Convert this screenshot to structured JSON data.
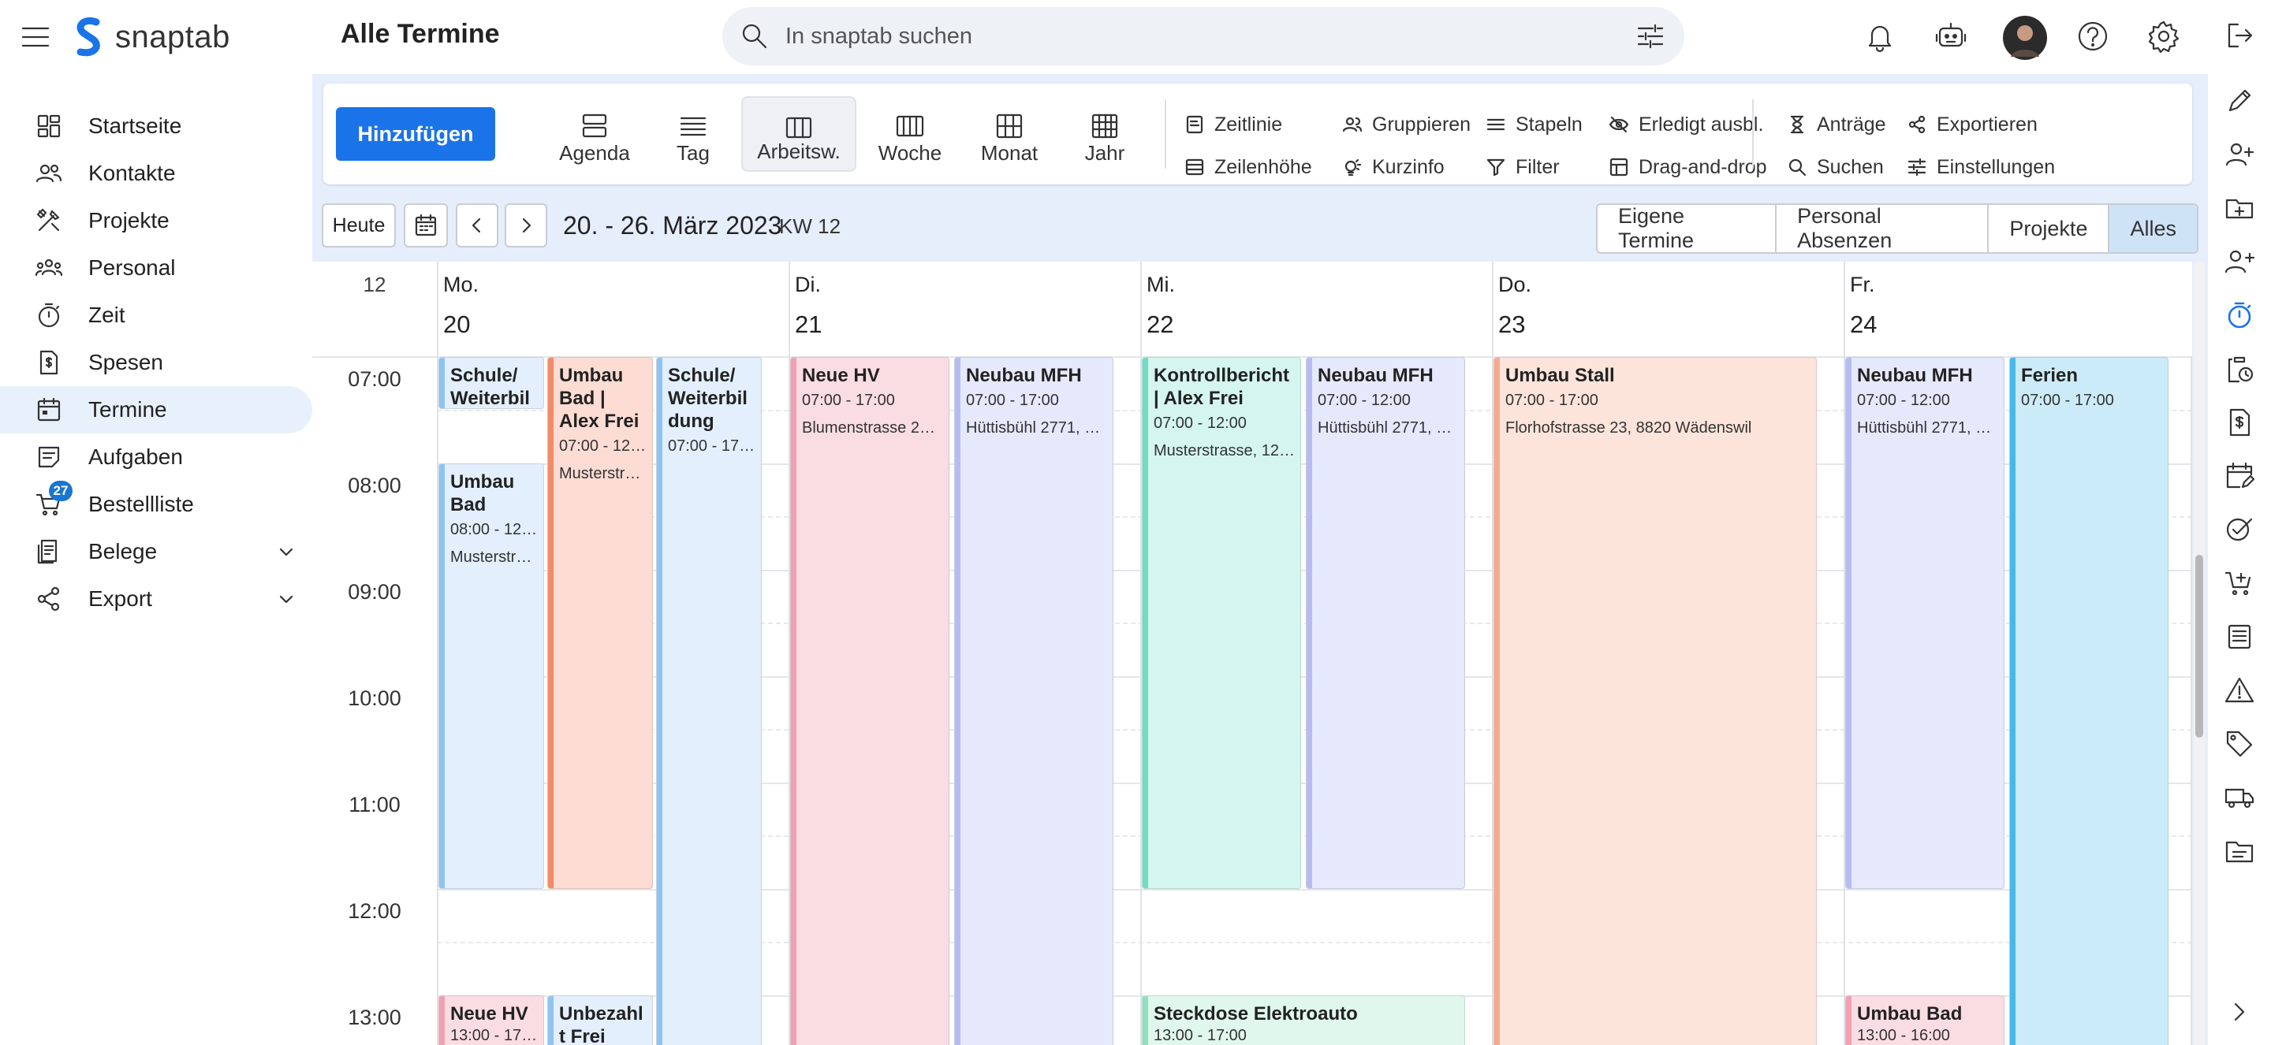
{
  "app": {
    "name": "snaptab",
    "page_title": "Alle Termine"
  },
  "search": {
    "placeholder": "In snaptab suchen"
  },
  "sidebar": {
    "items": [
      {
        "label": "Startseite",
        "icon": "dashboard-icon"
      },
      {
        "label": "Kontakte",
        "icon": "people-icon"
      },
      {
        "label": "Projekte",
        "icon": "tools-icon"
      },
      {
        "label": "Personal",
        "icon": "groups-icon"
      },
      {
        "label": "Zeit",
        "icon": "timer-icon"
      },
      {
        "label": "Spesen",
        "icon": "receipt-icon"
      },
      {
        "label": "Termine",
        "icon": "calendar-icon",
        "active": true
      },
      {
        "label": "Aufgaben",
        "icon": "task-icon"
      },
      {
        "label": "Bestellliste",
        "icon": "cart-icon",
        "badge": "27"
      },
      {
        "label": "Belege",
        "icon": "document-icon",
        "expandable": true
      },
      {
        "label": "Export",
        "icon": "share-icon",
        "expandable": true
      }
    ]
  },
  "toolbar": {
    "add_label": "Hinzufügen",
    "views": [
      {
        "label": "Agenda"
      },
      {
        "label": "Tag"
      },
      {
        "label": "Arbeitsw.",
        "active": true
      },
      {
        "label": "Woche"
      },
      {
        "label": "Monat"
      },
      {
        "label": "Jahr"
      }
    ],
    "options": {
      "zeitlinie": "Zeitlinie",
      "zeilenhoehe": "Zeilenhöhe",
      "gruppieren": "Gruppieren",
      "kurzinfo": "Kurzinfo",
      "stapeln": "Stapeln",
      "filter": "Filter",
      "erledigt": "Erledigt ausbl.",
      "dragdrop": "Drag-and-drop",
      "antraege": "Anträge",
      "suchen": "Suchen",
      "exportieren": "Exportieren",
      "einstellungen": "Einstellungen"
    }
  },
  "navigation": {
    "today_label": "Heute",
    "date_range": "20. - 26. März 2023",
    "week": "KW 12",
    "filters": [
      {
        "label": "Eigene Termine"
      },
      {
        "label": "Personal Absenzen"
      },
      {
        "label": "Projekte"
      },
      {
        "label": "Alles",
        "selected": true
      }
    ]
  },
  "calendar": {
    "week_number": "12",
    "days": [
      {
        "name": "Mo.",
        "date": "20"
      },
      {
        "name": "Di.",
        "date": "21"
      },
      {
        "name": "Mi.",
        "date": "22"
      },
      {
        "name": "Do.",
        "date": "23"
      },
      {
        "name": "Fr.",
        "date": "24"
      }
    ],
    "hours": [
      "07:00",
      "08:00",
      "09:00",
      "10:00",
      "11:00",
      "12:00",
      "13:00"
    ],
    "events": [
      {
        "title": "Schule/ Weiterbil",
        "time": "",
        "address": "",
        "color": "#e3effc",
        "bar": "#90c4f0"
      },
      {
        "title": "Umbau Bad",
        "time": "08:00 - 12:…",
        "address": "Musterstr…",
        "color": "#e3effc",
        "bar": "#90c4f0"
      },
      {
        "title": "Umbau Bad | Alex Frei",
        "time": "07:00 - 12:…",
        "address": "Musterstr…",
        "color": "#fcdcd3",
        "bar": "#f48a6a"
      },
      {
        "title": "Schule/ Weiterbil dung",
        "time": "07:00 - 17:…",
        "address": "",
        "color": "#e3effc",
        "bar": "#90c4f0"
      },
      {
        "title": "Neue HV",
        "time": "13:00 - 17:…",
        "address": "",
        "color": "#fadde3",
        "bar": "#f0a0b2"
      },
      {
        "title": "Unbezahl t Frei",
        "time": "",
        "address": "",
        "color": "#e3effc",
        "bar": "#90c4f0"
      },
      {
        "title": "Neue HV",
        "time": "07:00 - 17:00",
        "address": "Blumenstrasse 2…",
        "color": "#fadde3",
        "bar": "#f0a0b2"
      },
      {
        "title": "Neubau MFH",
        "time": "07:00 - 17:00",
        "address": "Hüttisbühl 2771, …",
        "color": "#e6e8fb",
        "bar": "#b5bdf0"
      },
      {
        "title": "Kontrollbericht | Alex Frei",
        "time": "07:00 - 12:00",
        "address": "Musterstrasse, 12…",
        "color": "#d4f6ee",
        "bar": "#6fdcc3"
      },
      {
        "title": "Neubau MFH",
        "time": "07:00 - 12:00",
        "address": "Hüttisbühl 2771, …",
        "color": "#e6e8fb",
        "bar": "#b5bdf0"
      },
      {
        "title": "Steckdose Elektroauto",
        "time": "13:00 - 17:00",
        "address": "",
        "color": "#e0f7ee",
        "bar": "#8fe0c2"
      },
      {
        "title": "Umbau Stall",
        "time": "07:00 - 17:00",
        "address": "Florhofstrasse 23, 8820 Wädenswil",
        "color": "#fde4da",
        "bar": "#f4a98e"
      },
      {
        "title": "Neubau MFH",
        "time": "07:00 - 12:00",
        "address": "Hüttisbühl 2771, …",
        "color": "#e6e8fb",
        "bar": "#b5bdf0"
      },
      {
        "title": "Ferien",
        "time": "07:00 - 17:00",
        "address": "",
        "color": "#ccebf8",
        "bar": "#47b9e6"
      },
      {
        "title": "Umbau Bad",
        "time": "13:00 - 16:00",
        "address": "",
        "color": "#fadde3",
        "bar": "#f0a0b2"
      }
    ]
  }
}
